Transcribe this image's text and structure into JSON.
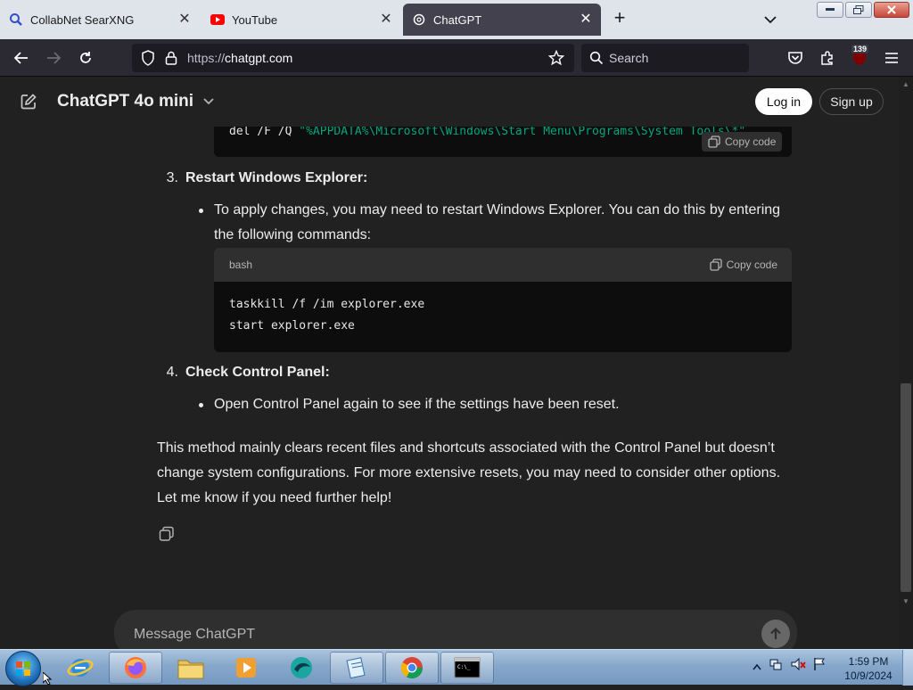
{
  "browser": {
    "tabs": [
      {
        "title": "CollabNet SearXNG",
        "active": false
      },
      {
        "title": "YouTube",
        "active": false
      },
      {
        "title": "ChatGPT",
        "active": true
      }
    ],
    "url_scheme": "https://",
    "url_host": "chatgpt.com",
    "search_placeholder": "Search",
    "extension_badge": "139"
  },
  "header": {
    "model": "ChatGPT 4o mini",
    "login": "Log in",
    "signup": "Sign up"
  },
  "content": {
    "code_top": {
      "cmd": "del /F /Q ",
      "arg": "\"%APPDATA%\\Microsoft\\Windows\\Start Menu\\Programs\\System Tools\\*\"",
      "copy": "Copy code"
    },
    "step3": {
      "num": "3.",
      "title": "Restart Windows Explorer:"
    },
    "step3_bullet_l1": "To apply changes, you may need to restart Windows Explorer. You can do this by entering",
    "step3_bullet_l2": "the following commands:",
    "code_block": {
      "lang": "bash",
      "copy": "Copy code",
      "line1": "taskkill /f /im explorer.exe",
      "line2": "start explorer.exe"
    },
    "step4": {
      "num": "4.",
      "title": "Check Control Panel:"
    },
    "step4_bullet": "Open Control Panel again to see if the settings have been reset.",
    "para_l1": "This method mainly clears recent files and shortcuts associated with the Control Panel but doesn’t",
    "para_l2": "change system configurations. For more extensive resets, you may need to consider other options.",
    "para_l3": "Let me know if you need further help!"
  },
  "composer": {
    "placeholder": "Message ChatGPT"
  },
  "taskbar": {
    "time": "1:59 PM",
    "date": "10/9/2024"
  },
  "colors": {
    "page_bg": "#212121",
    "code_string": "#00a67d",
    "active_tab": "#42414d"
  }
}
